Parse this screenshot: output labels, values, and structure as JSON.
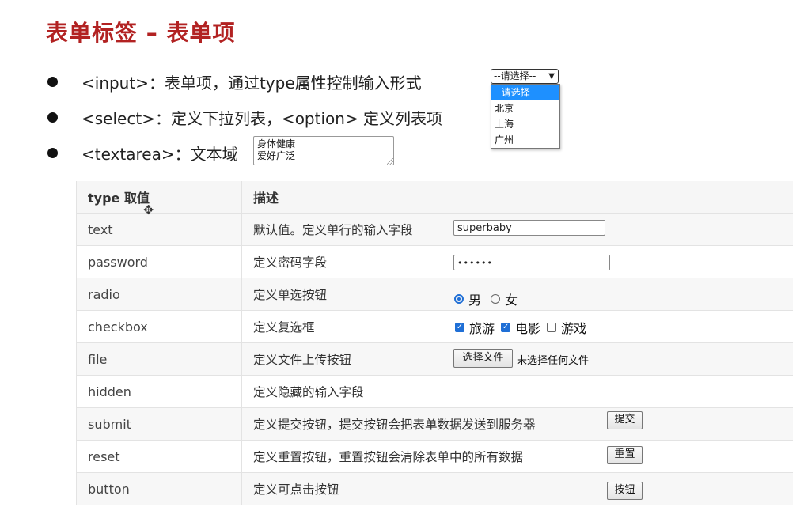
{
  "title": "表单标签 – 表单项",
  "bullets": [
    "<input>：表单项，通过type属性控制输入形式",
    "<select>：定义下拉列表，<option> 定义列表项",
    "<textarea>：文本域"
  ],
  "textarea_value": "身体健康\n爱好广泛",
  "select": {
    "selected": "--请选择--",
    "options": [
      "--请选择--",
      "北京",
      "上海",
      "广州"
    ]
  },
  "table": {
    "headers": [
      "type 取值",
      "描述"
    ],
    "rows": [
      {
        "type": "text",
        "desc": "默认值。定义单行的输入字段"
      },
      {
        "type": "password",
        "desc": "定义密码字段"
      },
      {
        "type": "radio",
        "desc": "定义单选按钮"
      },
      {
        "type": "checkbox",
        "desc": "定义复选框"
      },
      {
        "type": "file",
        "desc": "定义文件上传按钮"
      },
      {
        "type": "hidden",
        "desc": "定义隐藏的输入字段"
      },
      {
        "type": "submit",
        "desc": "定义提交按钮，提交按钮会把表单数据发送到服务器"
      },
      {
        "type": "reset",
        "desc": "定义重置按钮，重置按钮会清除表单中的所有数据"
      },
      {
        "type": "button",
        "desc": "定义可点击按钮"
      }
    ]
  },
  "demos": {
    "text_value": "superbaby",
    "password_value": "••••••",
    "radio": [
      {
        "label": "男",
        "checked": true
      },
      {
        "label": "女",
        "checked": false
      }
    ],
    "checkbox": [
      {
        "label": "旅游",
        "checked": true
      },
      {
        "label": "电影",
        "checked": true
      },
      {
        "label": "游戏",
        "checked": false
      }
    ],
    "file_button": "选择文件",
    "file_status": "未选择任何文件",
    "submit_label": "提交",
    "reset_label": "重置",
    "button_label": "按钮"
  },
  "colors": {
    "title": "#b22222",
    "accent": "#1f6fd6"
  }
}
